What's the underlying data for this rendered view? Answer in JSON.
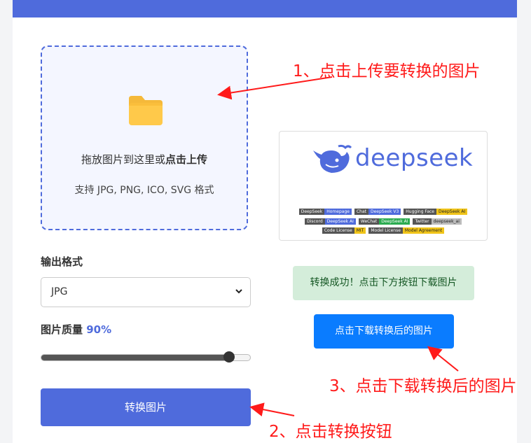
{
  "upload": {
    "prompt_prefix": "拖放图片到这里或",
    "prompt_bold": "点击上传",
    "supported": "支持 JPG, PNG, ICO, SVG 格式"
  },
  "settings": {
    "format_label": "输出格式",
    "format_value": "JPG",
    "quality_label": "图片质量",
    "quality_value": "90%",
    "quality_fraction": 0.9
  },
  "convert_button": "转换图片",
  "preview": {
    "brand": "deepseek",
    "badges": [
      [
        [
          "DeepSeek",
          "Homepage",
          "#4f6bdc"
        ],
        [
          "Chat",
          "DeepSeek V3",
          "#4f6bdc"
        ],
        [
          "Hugging Face",
          "DeepSeek AI",
          "#f0c419"
        ]
      ],
      [
        [
          "Discord",
          "DeepSeek AI",
          "#4f6bdc"
        ],
        [
          "WeChat",
          "DeepSeek AI",
          "#2bab50"
        ],
        [
          "Twitter",
          "deepseek_ai",
          "#bbbbbb"
        ]
      ],
      [
        [
          "Code License",
          "MIT",
          "#f0c419"
        ],
        [
          "Model License",
          "Model Agreement",
          "#f0c419"
        ]
      ]
    ]
  },
  "status": {
    "success": "转换成功！点击下方按钮下载图片",
    "download_button": "点击下载转换后的图片"
  },
  "annotations": {
    "step1": "1、点击上传要转换的图片",
    "step2": "2、点击转换按钮",
    "step3": "3、点击下载转换后的图片"
  },
  "colors": {
    "accent": "#4f6bdc",
    "download": "#0a7cff",
    "success_bg": "#d4edda",
    "annotation": "#ff1a1a"
  }
}
